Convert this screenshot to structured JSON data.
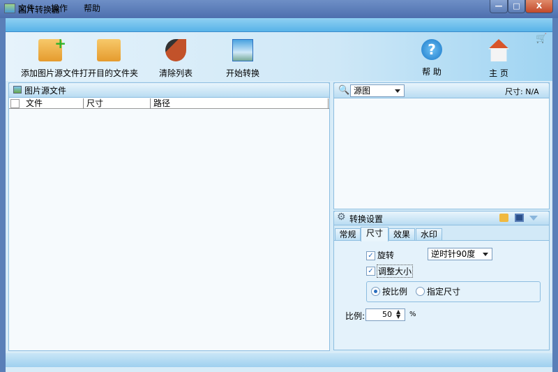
{
  "window": {
    "title": "图片转换器",
    "minimize": "—",
    "maximize": "□",
    "close": "X"
  },
  "menu": [
    "文件",
    "操作",
    "帮助"
  ],
  "toolbar": {
    "add_source": "添加图片源文件",
    "open_dest": "打开目的文件夹",
    "clear_list": "清除列表",
    "start_convert": "开始转换",
    "help": "帮 助",
    "home": "主 页"
  },
  "source_panel": {
    "title": "图片源文件",
    "columns": [
      "文件",
      "尺寸",
      "路径"
    ]
  },
  "preview": {
    "view_select": "源图",
    "size_label": "尺寸:",
    "size_value": "N/A"
  },
  "settings": {
    "title": "转换设置",
    "tabs": [
      "常规",
      "尺寸",
      "效果",
      "水印"
    ],
    "active_tab": 1,
    "rotate_label": "旋转",
    "rotate_checked": true,
    "rotate_option": "逆时针90度",
    "resize_label": "调整大小",
    "resize_checked": true,
    "by_ratio": "按比例",
    "by_size": "指定尺寸",
    "selected_mode": "by_ratio",
    "ratio_label": "比例:",
    "ratio_value": "50",
    "ratio_unit": "%"
  }
}
